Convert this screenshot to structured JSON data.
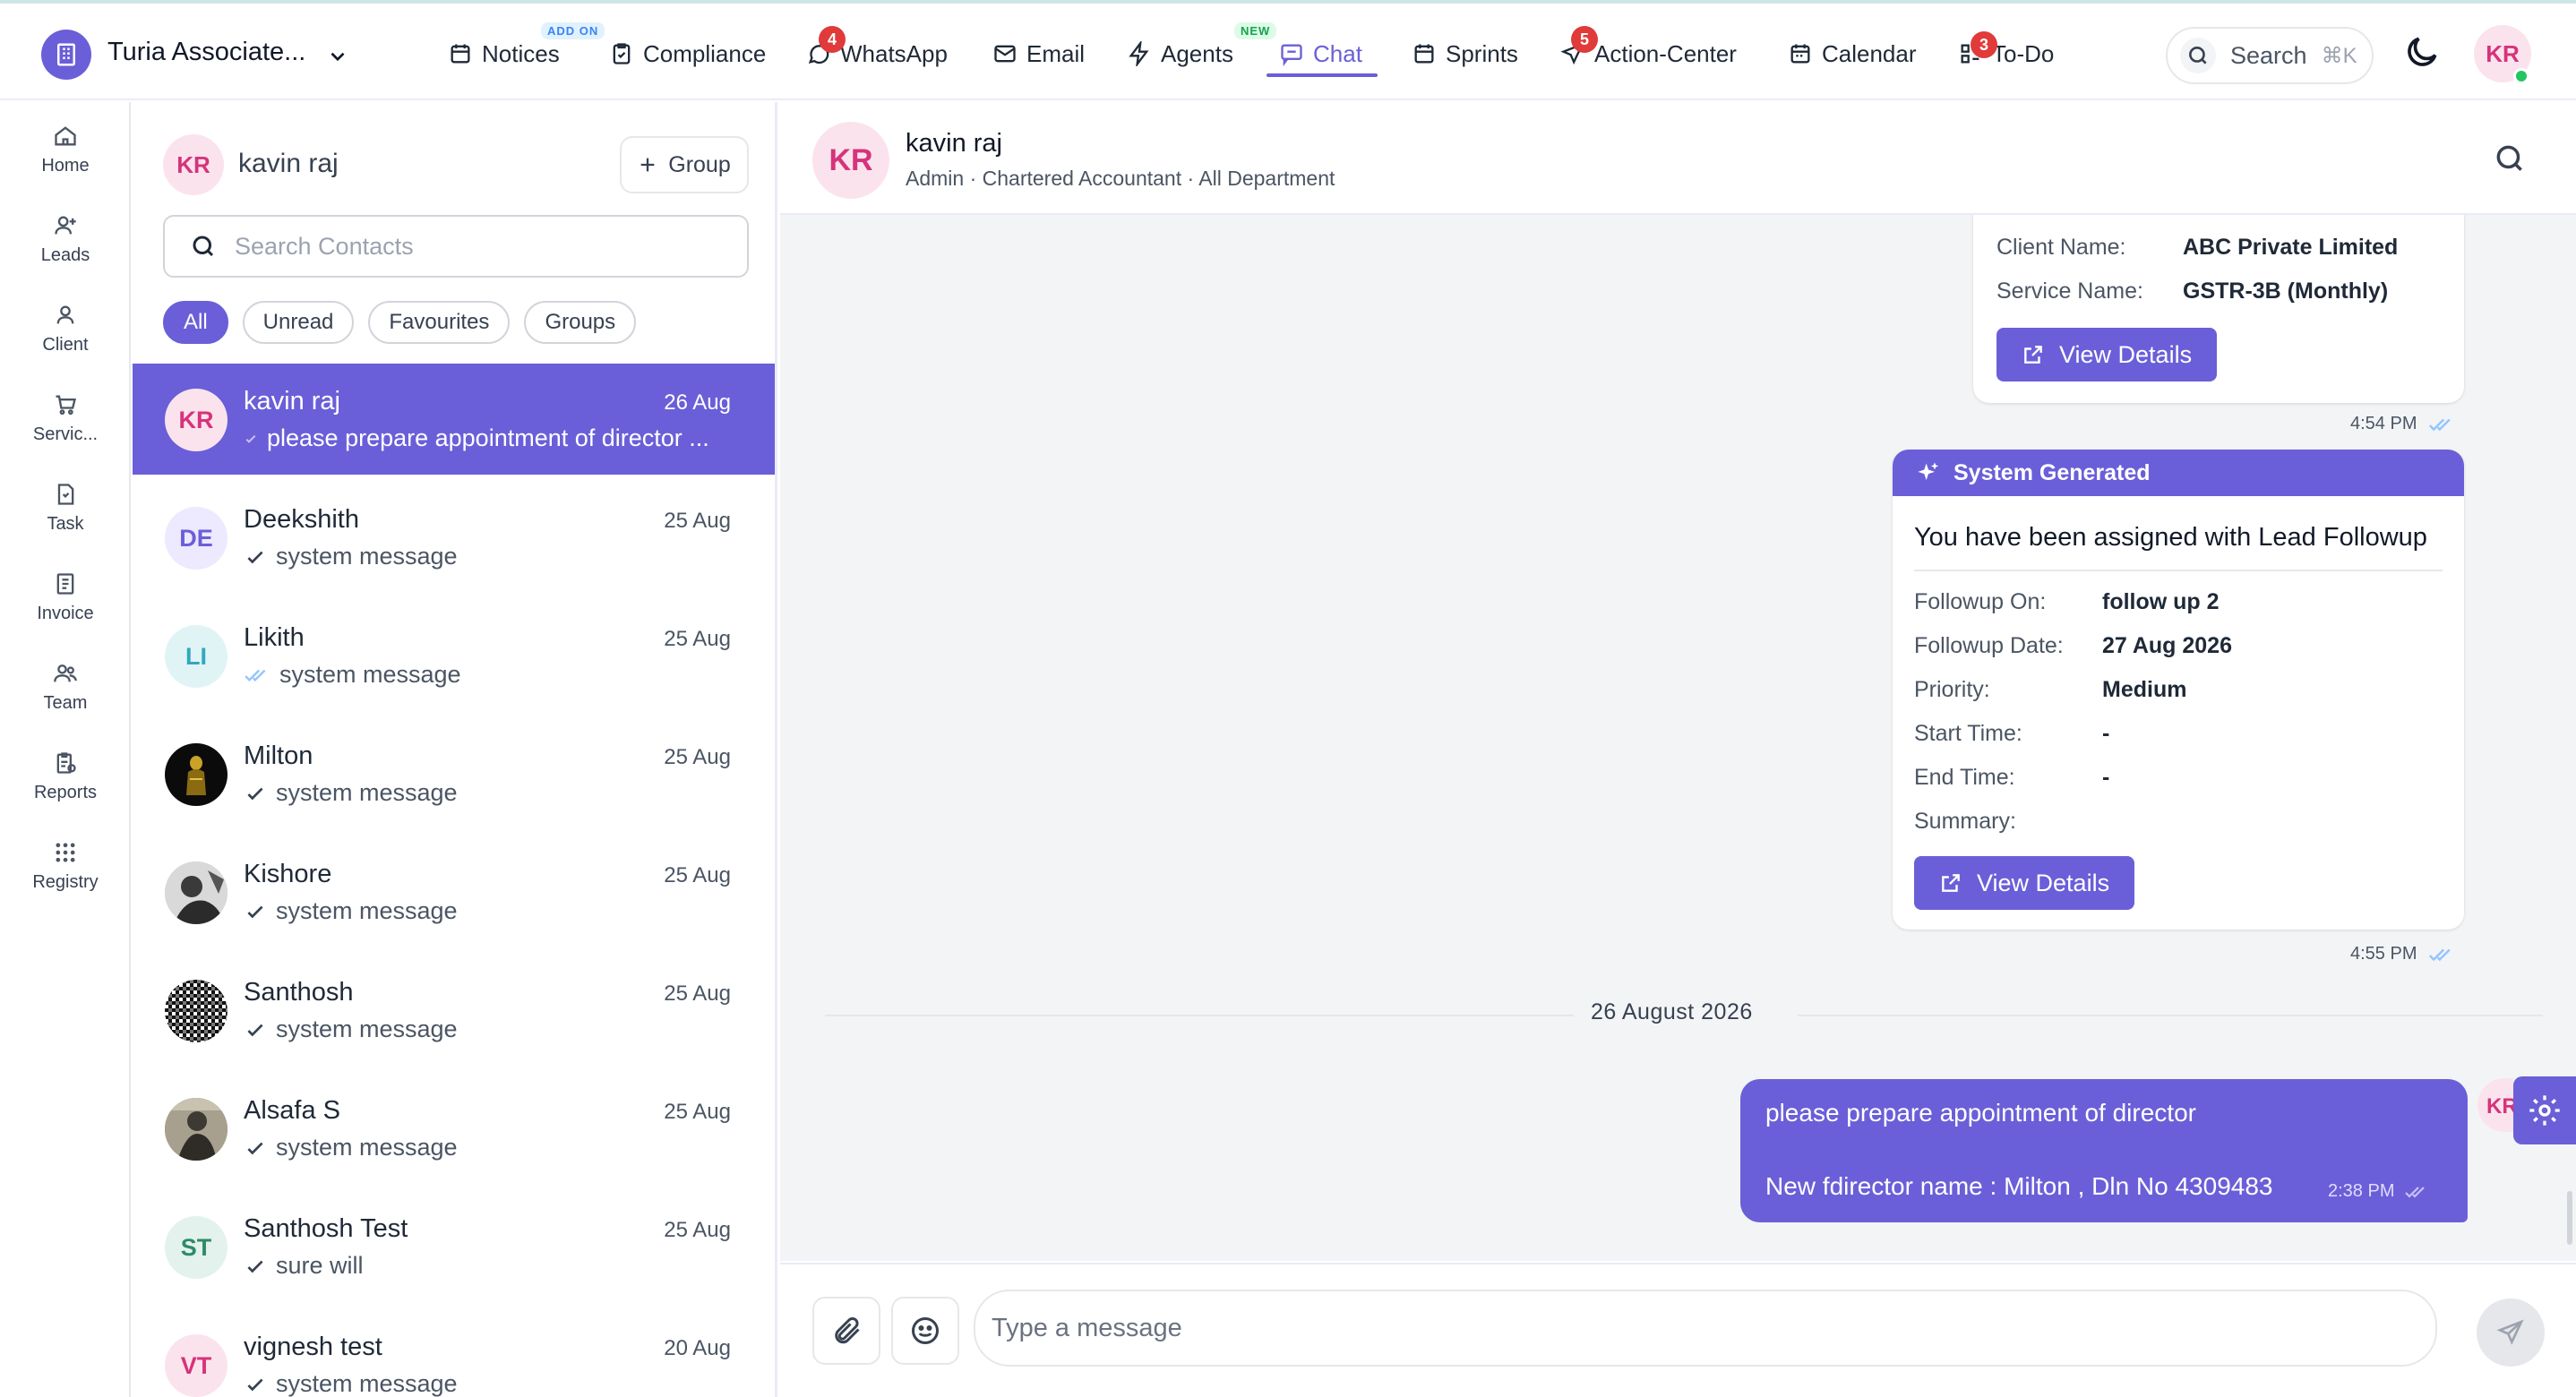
{
  "org": {
    "name": "Turia Associate..."
  },
  "nav": {
    "notices": {
      "label": "Notices",
      "tag": "ADD ON"
    },
    "compliance": {
      "label": "Compliance"
    },
    "whatsapp": {
      "label": "WhatsApp",
      "badge": "4"
    },
    "email": {
      "label": "Email"
    },
    "agents": {
      "label": "Agents",
      "tag": "NEW"
    },
    "chat": {
      "label": "Chat"
    },
    "sprints": {
      "label": "Sprints"
    },
    "action_center": {
      "label": "Action-Center",
      "badge": "5"
    },
    "calendar": {
      "label": "Calendar"
    },
    "todo": {
      "label": "To-Do",
      "badge": "3"
    }
  },
  "search": {
    "label": "Search",
    "shortcut": "⌘K"
  },
  "user": {
    "initials": "KR"
  },
  "sidebar": {
    "items": [
      {
        "label": "Home",
        "icon": "home-icon"
      },
      {
        "label": "Leads",
        "icon": "user-plus-icon"
      },
      {
        "label": "Client",
        "icon": "user-icon"
      },
      {
        "label": "Servic...",
        "icon": "cart-icon"
      },
      {
        "label": "Task",
        "icon": "task-icon"
      },
      {
        "label": "Invoice",
        "icon": "invoice-icon"
      },
      {
        "label": "Team",
        "icon": "team-icon"
      },
      {
        "label": "Reports",
        "icon": "reports-icon"
      },
      {
        "label": "Registry",
        "icon": "grid-icon"
      }
    ]
  },
  "contacts_panel": {
    "me": {
      "initials": "KR",
      "name": "kavin raj"
    },
    "group_button": "Group",
    "search_placeholder": "Search Contacts",
    "filters": [
      "All",
      "Unread",
      "Favourites",
      "Groups"
    ],
    "list": [
      {
        "initials": "KR",
        "name": "kavin raj",
        "date": "26 Aug",
        "preview": "please prepare appointment of director ...",
        "status": "sent"
      },
      {
        "initials": "DE",
        "name": "Deekshith",
        "date": "25 Aug",
        "preview": "system message",
        "status": "check"
      },
      {
        "initials": "LI",
        "name": "Likith",
        "date": "25 Aug",
        "preview": "system message",
        "status": "read"
      },
      {
        "initials": "",
        "name": "Milton",
        "date": "25 Aug",
        "preview": "system message",
        "status": "check"
      },
      {
        "initials": "",
        "name": "Kishore",
        "date": "25 Aug",
        "preview": "system message",
        "status": "check"
      },
      {
        "initials": "",
        "name": "Santhosh",
        "date": "25 Aug",
        "preview": "system message",
        "status": "check"
      },
      {
        "initials": "",
        "name": "Alsafa S",
        "date": "25 Aug",
        "preview": "system message",
        "status": "check"
      },
      {
        "initials": "ST",
        "name": "Santhosh Test",
        "date": "25 Aug",
        "preview": "sure will",
        "status": "check"
      },
      {
        "initials": "VT",
        "name": "vignesh test",
        "date": "20 Aug",
        "preview": "system message",
        "status": "check"
      }
    ]
  },
  "chat_header": {
    "initials": "KR",
    "name": "kavin raj",
    "subtitle": "Admin · Chartered Accountant · All Department"
  },
  "messages": {
    "card1": {
      "fields": [
        {
          "label": "Client Name:",
          "value": "ABC Private Limited"
        },
        {
          "label": "Service Name:",
          "value": "GSTR-3B (Monthly)"
        }
      ],
      "button": "View Details",
      "time": "4:54 PM"
    },
    "card2": {
      "header": "System Generated",
      "title": "You have been assigned with Lead Followup",
      "fields": [
        {
          "label": "Followup On:",
          "value": "follow up 2"
        },
        {
          "label": "Followup Date:",
          "value": "27 Aug 2026"
        },
        {
          "label": "Priority:",
          "value": "Medium"
        },
        {
          "label": "Start Time:",
          "value": "-"
        },
        {
          "label": "End Time:",
          "value": "-"
        },
        {
          "label": "Summary:",
          "value": ""
        }
      ],
      "button": "View Details",
      "time": "4:55 PM"
    },
    "date_separator": "26 August 2026",
    "outgoing": {
      "line1": "please prepare appointment of director",
      "line2": "New fdirector name : Milton , Dln No 4309483",
      "time": "2:38 PM",
      "avatar": "KR"
    }
  },
  "composer": {
    "placeholder": "Type a message"
  },
  "colors": {
    "accent": "#6a5fd8",
    "badge": "#e03a3a",
    "avatar_bg": "#fbe3ee",
    "avatar_text": "#d6337a"
  }
}
